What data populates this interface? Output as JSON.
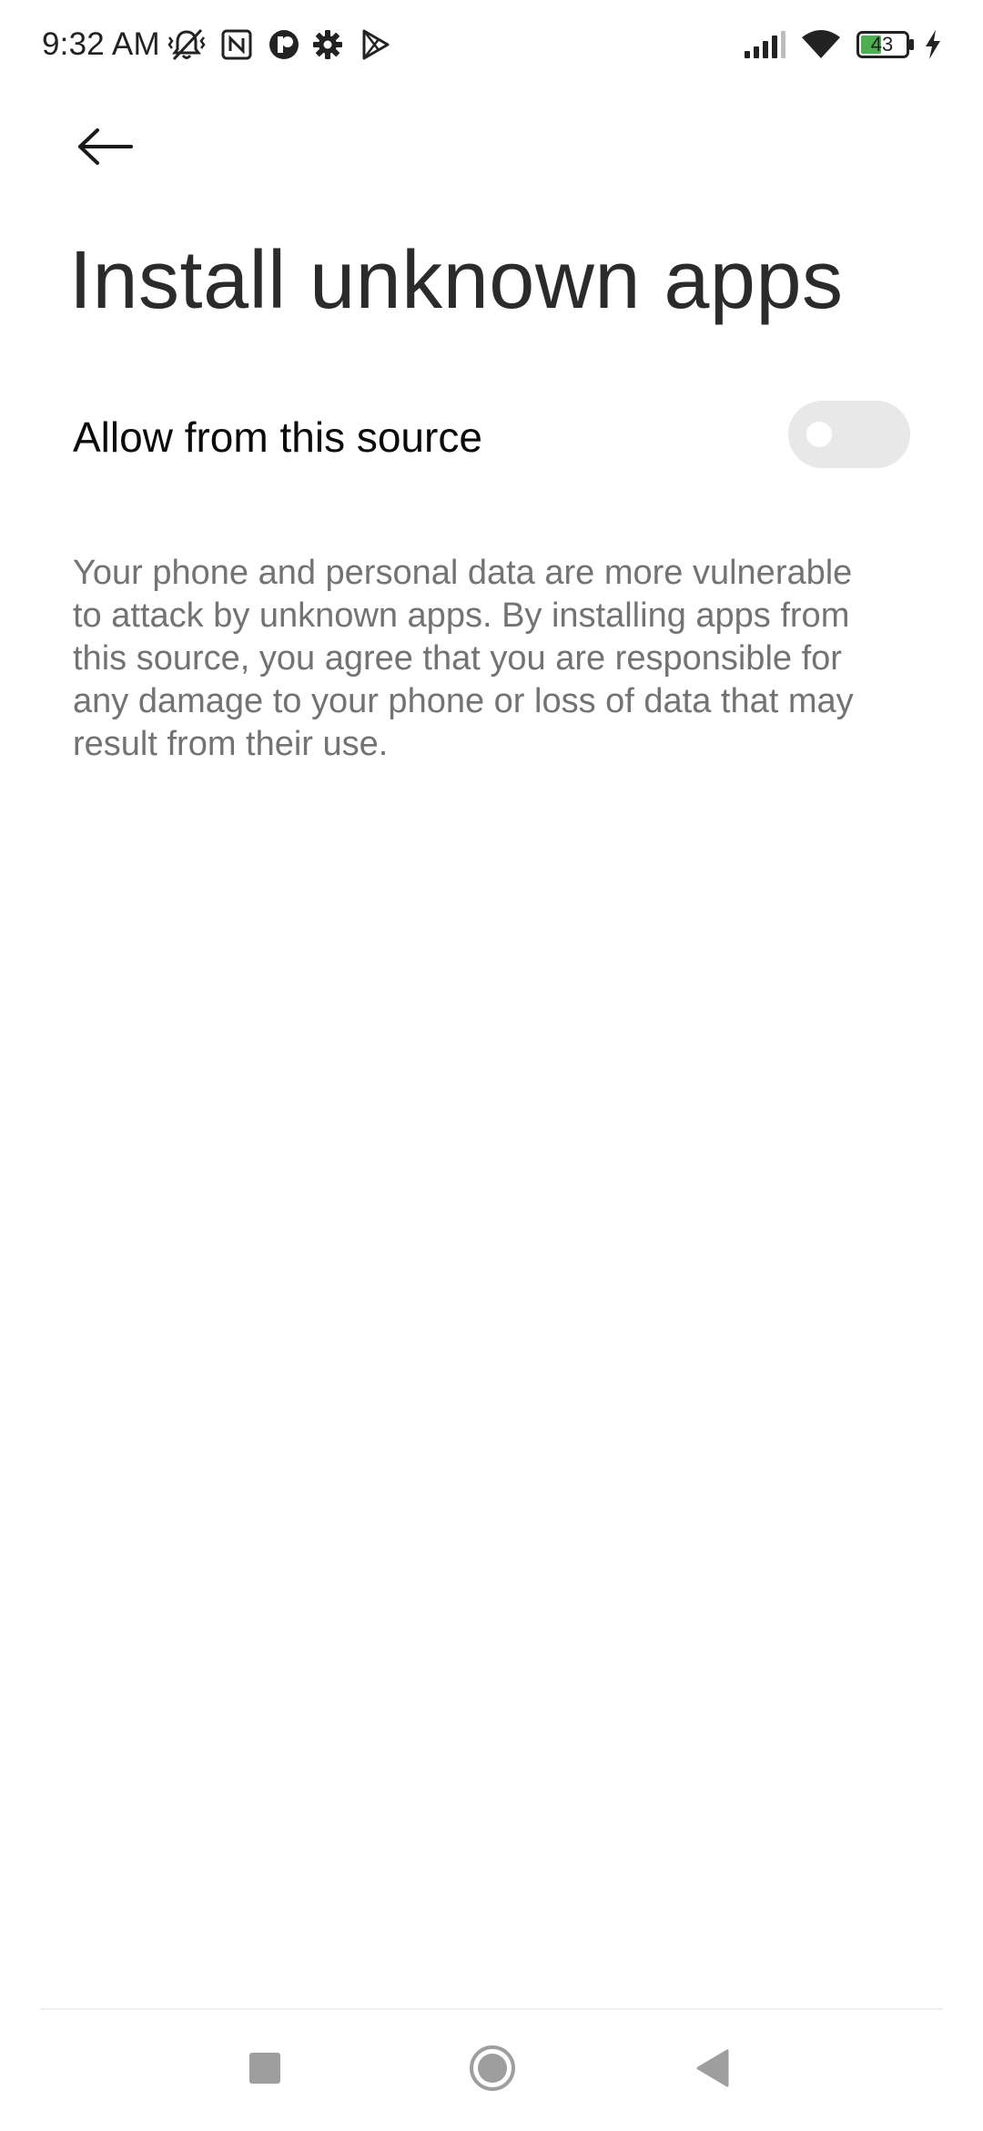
{
  "status_bar": {
    "time": "9:32 AM",
    "battery_level": "43",
    "icons": [
      "vibrate-off-icon",
      "nfc-icon",
      "app-notification-icon",
      "gear-icon",
      "play-store-icon",
      "signal-icon",
      "wifi-icon",
      "battery-icon",
      "charging-icon"
    ]
  },
  "header": {
    "back_icon": "arrow-left-icon",
    "title": "Install unknown apps"
  },
  "setting": {
    "label": "Allow from this source",
    "toggle_on": false
  },
  "description": "Your phone and personal data are more vulnerable to attack by unknown apps. By installing apps from this source, you agree that you are responsible for any damage to your phone or loss of data that may result from their use.",
  "nav_bar": {
    "buttons": [
      "recents-square-icon",
      "home-circle-icon",
      "back-triangle-icon"
    ]
  },
  "colors": {
    "title": "#2b2b2b",
    "description": "#737373",
    "toggle_off_track": "#e8e8e8",
    "battery_fill": "#4caf50",
    "nav_icon": "#9e9e9e"
  }
}
